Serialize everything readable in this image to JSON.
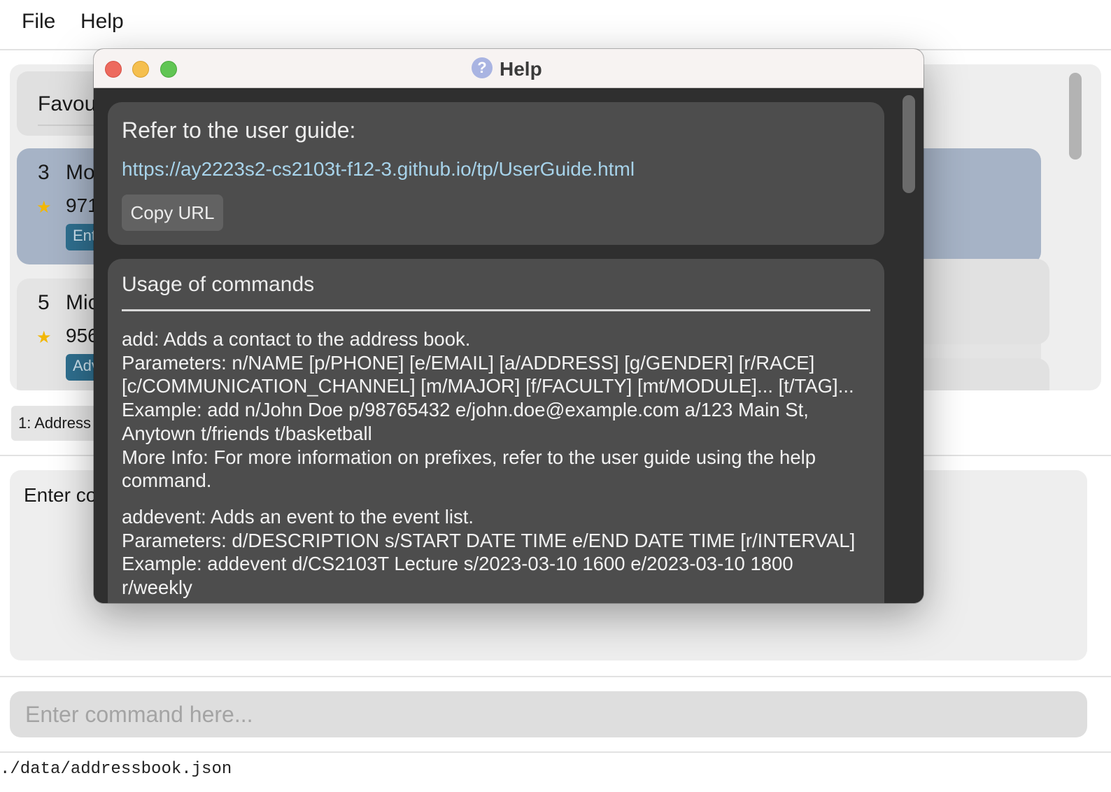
{
  "menu": {
    "file": "File",
    "help": "Help"
  },
  "person_list": {
    "header": "Favou",
    "cards": [
      {
        "index": "3",
        "name": "Mo",
        "phone": "971",
        "tag": "Ent",
        "favourite": true
      },
      {
        "index": "5",
        "name": "Mic",
        "phone": "956",
        "tag": "Adv",
        "favourite": true
      }
    ]
  },
  "status_chip": "1: Address",
  "result_display": "Enter co",
  "command_box": {
    "placeholder": "Enter command here..."
  },
  "status_bar": {
    "path": "./data/addressbook.json"
  },
  "help_window": {
    "title": "Help",
    "guide_label": "Refer to the user guide:",
    "guide_url": "https://ay2223s2-cs2103t-f12-3.github.io/tp/UserGuide.html",
    "copy_button": "Copy URL",
    "usage_title": "Usage of commands",
    "commands": [
      {
        "lines": [
          "add: Adds a contact to the address book.",
          "Parameters: n/NAME [p/PHONE] [e/EMAIL] [a/ADDRESS] [g/GENDER] [r/RACE]",
          "[c/COMMUNICATION_CHANNEL] [m/MAJOR] [f/FACULTY] [mt/MODULE]... [t/TAG]...",
          "Example: add n/John Doe p/98765432 e/john.doe@example.com a/123 Main St,",
          "Anytown t/friends t/basketball",
          "More Info: For more information on prefixes, refer to the user guide using the help",
          "command."
        ]
      },
      {
        "lines": [
          "addevent: Adds an event to the event list.",
          "Parameters: d/DESCRIPTION s/START DATE TIME e/END DATE TIME [r/INTERVAL]",
          "Example: addevent d/CS2103T Lecture s/2023-03-10 1600 e/2023-03-10 1800",
          "r/weekly"
        ]
      }
    ]
  },
  "colors": {
    "card_selected": "#a6b3c6",
    "tag_bg": "#2f6f8f",
    "link": "#a7d3ea",
    "help_panel": "#4d4d4d",
    "star": "#f2b705"
  }
}
